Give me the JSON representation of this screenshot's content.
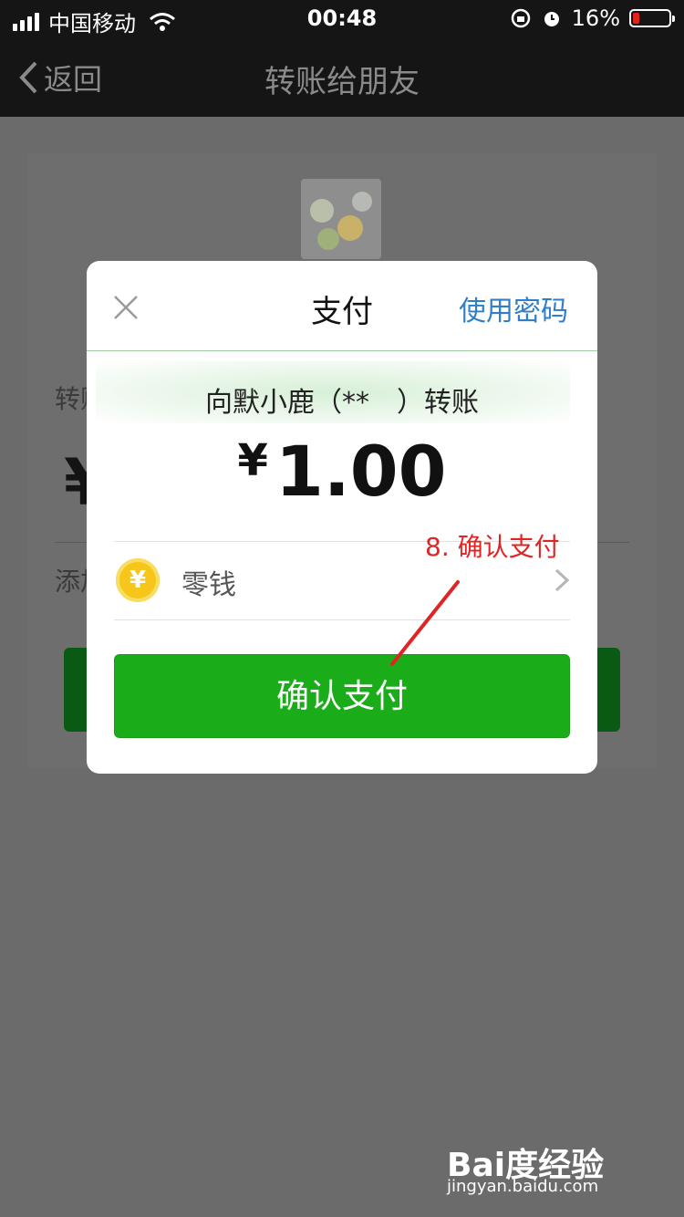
{
  "status_bar": {
    "carrier": "中国移动",
    "time": "00:48",
    "battery": "16%",
    "battery_level": 0.16
  },
  "nav": {
    "back_label": "返回",
    "title": "转账给朋友"
  },
  "background": {
    "amount_label": "转账金额",
    "currency_symbol": "¥",
    "note_label": "添加转账说明"
  },
  "modal": {
    "title": "支付",
    "use_password": "使用密码",
    "recipient": "向默小鹿（**　）转账",
    "currency_symbol": "¥",
    "amount": "1.00",
    "payment_method": "零钱",
    "coin_symbol": "¥",
    "confirm_label": "确认支付"
  },
  "annotation": {
    "text": "8. 确认支付"
  },
  "watermark": {
    "logo": "Bai度经验",
    "url": "jingyan.baidu.com"
  },
  "colors": {
    "accent_green": "#1aad19",
    "link_blue": "#2f7fc8",
    "annotation_red": "#e02424",
    "battery_red": "#e0241c"
  }
}
